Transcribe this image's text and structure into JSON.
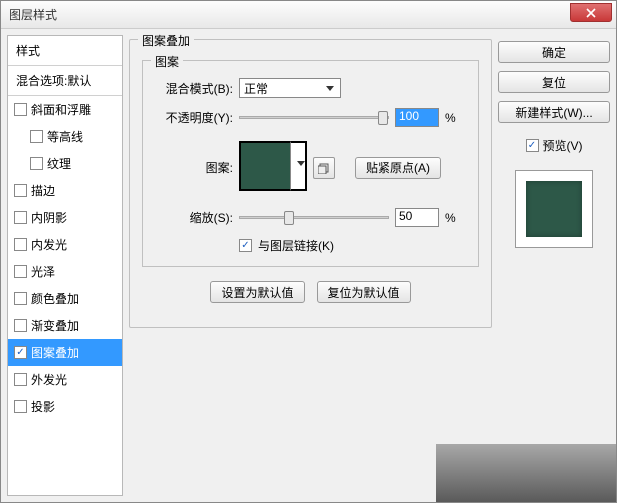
{
  "title": "图层样式",
  "close_icon": "close",
  "leftPanel": {
    "header": "样式",
    "sub": "混合选项:默认",
    "items": [
      {
        "label": "斜面和浮雕",
        "checked": false,
        "indent": false
      },
      {
        "label": "等高线",
        "checked": false,
        "indent": true
      },
      {
        "label": "纹理",
        "checked": false,
        "indent": true
      },
      {
        "label": "描边",
        "checked": false,
        "indent": false
      },
      {
        "label": "内阴影",
        "checked": false,
        "indent": false
      },
      {
        "label": "内发光",
        "checked": false,
        "indent": false
      },
      {
        "label": "光泽",
        "checked": false,
        "indent": false
      },
      {
        "label": "颜色叠加",
        "checked": false,
        "indent": false
      },
      {
        "label": "渐变叠加",
        "checked": false,
        "indent": false
      },
      {
        "label": "图案叠加",
        "checked": true,
        "indent": false,
        "selected": true
      },
      {
        "label": "外发光",
        "checked": false,
        "indent": false
      },
      {
        "label": "投影",
        "checked": false,
        "indent": false
      }
    ]
  },
  "center": {
    "groupTitle": "图案叠加",
    "innerTitle": "图案",
    "blendMode": {
      "label": "混合模式(B):",
      "value": "正常"
    },
    "opacity": {
      "label": "不透明度(Y):",
      "value": "100",
      "unit": "%",
      "pos": 100
    },
    "patternLabel": "图案:",
    "snap": "贴紧原点(A)",
    "scale": {
      "label": "缩放(S):",
      "value": "50",
      "unit": "%",
      "pos": 30
    },
    "link": {
      "label": "与图层链接(K)",
      "checked": true
    },
    "setDefault": "设置为默认值",
    "resetDefault": "复位为默认值"
  },
  "right": {
    "ok": "确定",
    "cancel": "复位",
    "newStyle": "新建样式(W)...",
    "preview": {
      "label": "预览(V)",
      "checked": true
    }
  }
}
